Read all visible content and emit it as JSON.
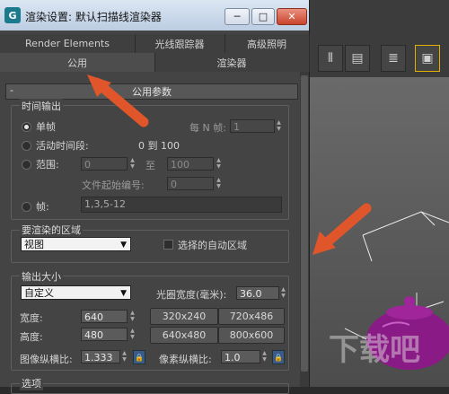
{
  "dialog": {
    "title": "渲染设置: 默认扫描线渲染器",
    "window_buttons": {
      "minimize": "─",
      "maximize": "□",
      "close": "✕"
    },
    "icon_letter": "G"
  },
  "tabs_row1": [
    "Render Elements",
    "光线跟踪器",
    "高级照明"
  ],
  "tabs_row2": [
    "公用",
    "渲染器"
  ],
  "rollout": {
    "toggle": "-",
    "title": "公用参数"
  },
  "time_output": {
    "label": "时间输出",
    "single_label": "单帧",
    "every_n_label": "每 N 帧:",
    "every_n_value": "1",
    "active_segment_label": "活动时间段:",
    "active_segment_range": "0 到 100",
    "range_label": "范围:",
    "range_start": "0",
    "range_to": "至",
    "range_end": "100",
    "file_start_label": "文件起始编号:",
    "file_start_value": "0",
    "frames_label": "帧:",
    "frames_value": "1,3,5-12"
  },
  "render_area": {
    "label": "要渲染的区域",
    "selected": "视图",
    "auto_region_label": "选择的自动区域"
  },
  "output_size": {
    "label": "输出大小",
    "preset": "自定义",
    "aperture_label": "光圈宽度(毫米):",
    "aperture_value": "36.0",
    "width_label": "宽度:",
    "width_value": "640",
    "height_label": "高度:",
    "height_value": "480",
    "presets": [
      "320x240",
      "720x486",
      "640x480",
      "800x600"
    ],
    "image_aspect_label": "图像纵横比:",
    "image_aspect_value": "1.333",
    "pixel_aspect_label": "像素纵横比:",
    "pixel_aspect_value": "1.0"
  },
  "options_label": "选项",
  "watermark": "下载吧",
  "colors": {
    "arrow": "#e0562a",
    "teapot": "#8a1a86"
  }
}
